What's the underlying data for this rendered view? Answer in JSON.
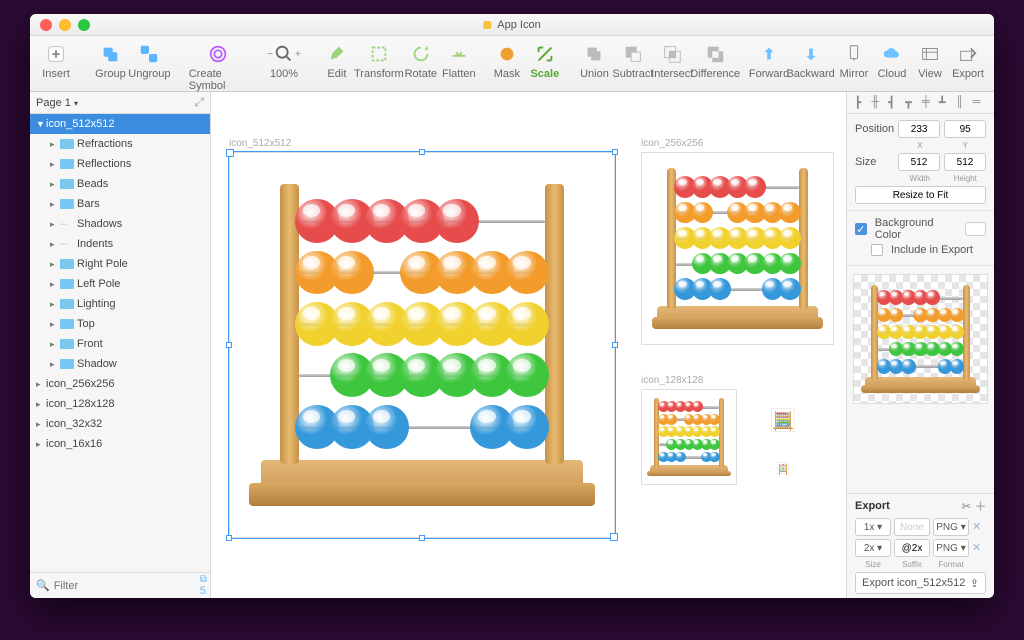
{
  "title": "App Icon",
  "toolbar": {
    "insert": "Insert",
    "group": "Group",
    "ungroup": "Ungroup",
    "create_symbol": "Create Symbol",
    "zoom": "100%",
    "edit": "Edit",
    "transform": "Transform",
    "rotate": "Rotate",
    "flatten": "Flatten",
    "mask": "Mask",
    "scale": "Scale",
    "union": "Union",
    "subtract": "Subtract",
    "intersect": "Intersect",
    "difference": "Difference",
    "forward": "Forward",
    "backward": "Backward",
    "mirror": "Mirror",
    "cloud": "Cloud",
    "view": "View",
    "export": "Export"
  },
  "pages": {
    "label": "Page 1",
    "count": "5"
  },
  "layers": {
    "selected": "icon_512x512",
    "children": [
      "Refractions",
      "Reflections",
      "Beads",
      "Bars",
      "Shadows",
      "Indents",
      "Right Pole",
      "Left Pole",
      "Lighting",
      "Top",
      "Front",
      "Shadow"
    ],
    "artboards": [
      "icon_256x256",
      "icon_128x128",
      "icon_32x32",
      "icon_16x16"
    ]
  },
  "filter_placeholder": "Filter",
  "canvas": {
    "ab1": "icon_512x512",
    "ab2": "icon_256x256",
    "ab3": "icon_128x128"
  },
  "inspector": {
    "position": "Position",
    "x": "233",
    "y": "95",
    "xl": "X",
    "yl": "Y",
    "size": "Size",
    "w": "512",
    "h": "512",
    "wl": "Width",
    "hl": "Height",
    "resize": "Resize to Fit",
    "bg": "Background Color",
    "include": "Include in Export"
  },
  "export": {
    "title": "Export",
    "rows": [
      {
        "scale": "1x",
        "suffix": "None",
        "format": "PNG"
      },
      {
        "scale": "2x",
        "suffix": "@2x",
        "format": "PNG"
      }
    ],
    "labels": {
      "size": "Size",
      "suffix": "Suffix",
      "format": "Format"
    },
    "button": "Export icon_512x512"
  },
  "abacus": {
    "rows": [
      {
        "color": "#e74c4c",
        "beads": [
          0,
          1,
          2,
          3,
          4
        ]
      },
      {
        "color": "#f39c2b",
        "beads": [
          0,
          1,
          3,
          4,
          5,
          6
        ]
      },
      {
        "color": "#f1d12e",
        "beads": [
          0,
          1,
          2,
          3,
          4,
          5,
          6
        ]
      },
      {
        "color": "#3ec63e",
        "beads": [
          1,
          2,
          3,
          4,
          5,
          6
        ]
      },
      {
        "color": "#3498db",
        "beads": [
          0,
          1,
          2,
          5,
          6
        ]
      }
    ]
  }
}
